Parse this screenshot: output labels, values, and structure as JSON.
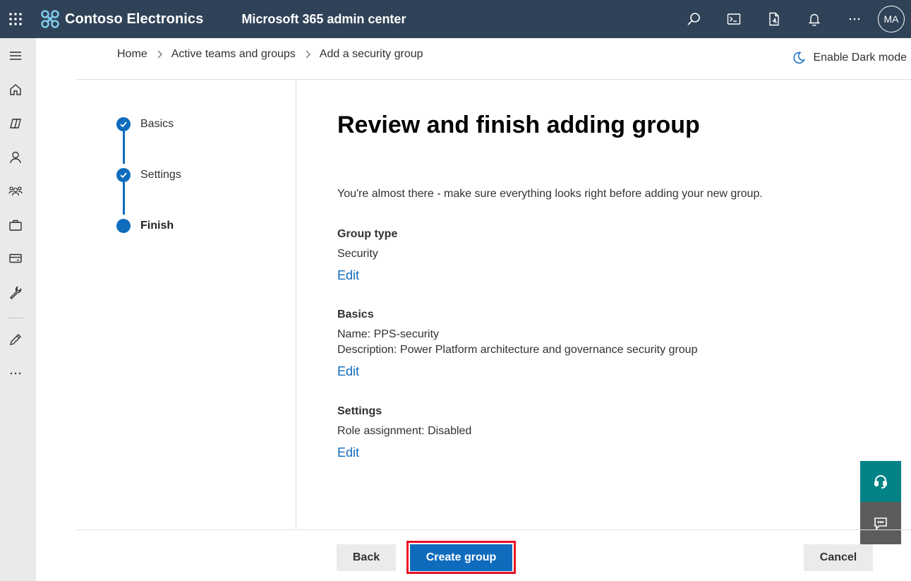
{
  "header": {
    "org_name": "Contoso Electronics",
    "app_title": "Microsoft 365 admin center",
    "avatar_initials": "MA",
    "bg_color": "#2f4257"
  },
  "rail": {
    "items": [
      "menu-icon",
      "home-icon",
      "copilot-icon",
      "user-icon",
      "groups-icon",
      "briefcase-icon",
      "billing-icon",
      "wrench-icon",
      "pencil-icon",
      "more-icon"
    ]
  },
  "breadcrumb": {
    "items": [
      "Home",
      "Active teams and groups",
      "Add a security group"
    ]
  },
  "dark_mode": {
    "label": "Enable Dark mode"
  },
  "stepper": {
    "steps": [
      {
        "label": "Basics",
        "state": "completed"
      },
      {
        "label": "Settings",
        "state": "completed"
      },
      {
        "label": "Finish",
        "state": "current"
      }
    ]
  },
  "main": {
    "title": "Review and finish adding group",
    "intro": "You're almost there - make sure everything looks right before adding your new group.",
    "sections": [
      {
        "title": "Group type",
        "lines": [
          "Security"
        ],
        "edit": "Edit"
      },
      {
        "title": "Basics",
        "lines": [
          "Name: PPS-security",
          "Description: Power Platform architecture and governance security group"
        ],
        "edit": "Edit"
      },
      {
        "title": "Settings",
        "lines": [
          "Role assignment: Disabled"
        ],
        "edit": "Edit"
      }
    ]
  },
  "footer": {
    "back_label": "Back",
    "create_label": "Create group",
    "cancel_label": "Cancel",
    "accent": "#0f6cbd",
    "highlight": "#e81123"
  }
}
